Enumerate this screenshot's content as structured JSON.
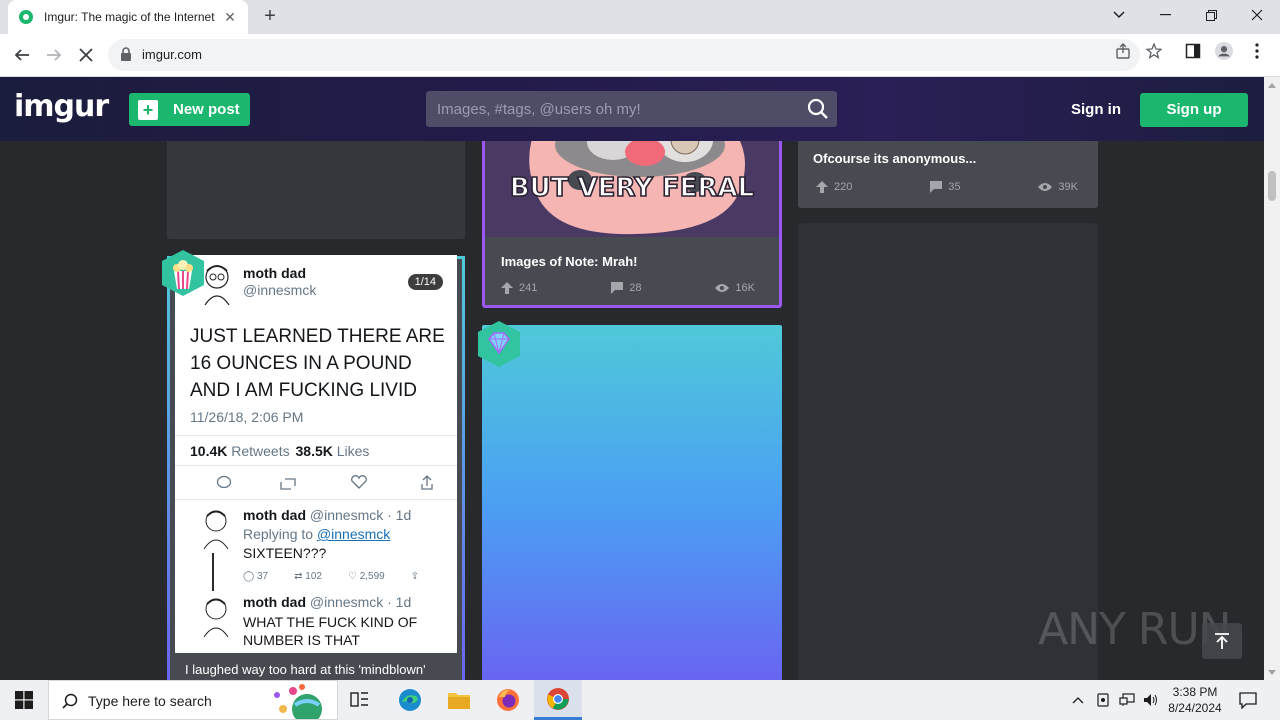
{
  "browser": {
    "tab_title": "Imgur: The magic of the Internet",
    "url": "imgur.com"
  },
  "imgur": {
    "logo": "imgur",
    "new_post_label": "New post",
    "search_placeholder": "Images, #tags, @users oh my!",
    "sign_in_label": "Sign in",
    "sign_up_label": "Sign up"
  },
  "posts": {
    "mrah": {
      "title": "Images of Note: Mrah!",
      "image_text": "BUT VERY FERAL",
      "upvotes": "241",
      "comments": "28",
      "views": "16K"
    },
    "anonymous": {
      "title": "Ofcourse its anonymous...",
      "upvotes": "220",
      "comments": "35",
      "views": "39K"
    },
    "mindblown": {
      "title": "I laughed way too hard at this 'mindblown'",
      "tweet": {
        "name": "moth dad",
        "handle": "@innesmck",
        "pager": "1/14",
        "text": "JUST LEARNED THERE ARE 16 OUNCES IN A POUND AND I AM FUCKING LIVID",
        "timestamp": "11/26/18, 2:06 PM",
        "retweets_count": "10.4K",
        "retweets_label": "Retweets",
        "likes_count": "38.5K",
        "likes_label": "Likes",
        "reply1_name": "moth dad",
        "reply1_meta": "@innesmck · 1d",
        "reply1_replying": "Replying to",
        "reply1_replying_handle": "@innesmck",
        "reply1_text": "SIXTEEN???",
        "reply1_replies": "37",
        "reply1_retweets": "102",
        "reply1_likes": "2,599",
        "reply2_name": "moth dad",
        "reply2_meta": "@innesmck · 1d",
        "reply2_text": "WHAT THE FUCK KIND OF NUMBER IS THAT"
      }
    }
  },
  "taskbar": {
    "search_placeholder": "Type here to search",
    "time": "3:38 PM",
    "date": "8/24/2024"
  },
  "watermark": "ANY RUN",
  "colors": {
    "imgur_green": "#1bb76e",
    "header_bg": "#1e1a3a",
    "page_bg": "#27292d",
    "card_bg": "#474a51"
  }
}
